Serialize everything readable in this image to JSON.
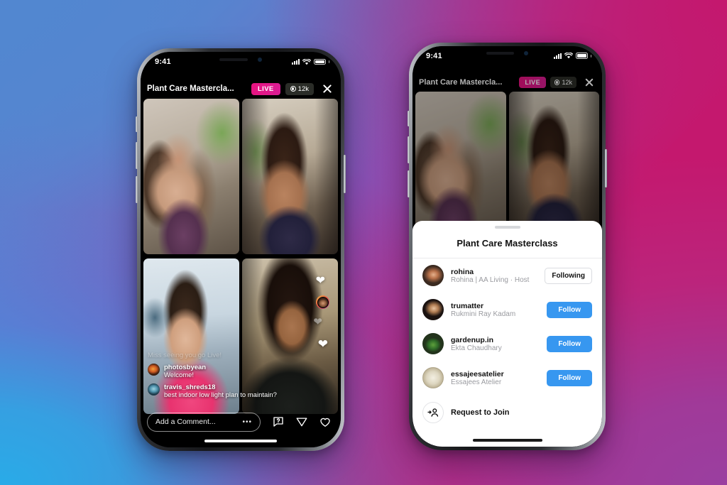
{
  "background": {
    "gradient_colors": [
      "#5287d0",
      "#29abe8",
      "#c4186e",
      "#9a3fa0"
    ]
  },
  "accents": {
    "live_pink": "#e8137f",
    "follow_blue": "#3797f0",
    "sheet_white": "#ffffff"
  },
  "phone_left": {
    "status_bar": {
      "time": "9:41",
      "signal_icon": "cellular-signal-icon",
      "wifi_icon": "wifi-icon",
      "battery_icon": "battery-icon"
    },
    "live_header": {
      "title": "Plant Care Mastercla...",
      "live_label": "LIVE",
      "viewer_count": "12k",
      "viewer_icon": "eye-icon",
      "close_icon": "close-icon"
    },
    "video_tiles": [
      {
        "name": "tile-top-left"
      },
      {
        "name": "tile-top-right"
      },
      {
        "name": "tile-bottom-left"
      },
      {
        "name": "tile-bottom-right"
      }
    ],
    "comments": [
      {
        "user": "",
        "text": "Miss seeing you go Live!",
        "faded": true
      },
      {
        "user": "photosbyean",
        "text": "Welcome!",
        "faded": false
      },
      {
        "user": "travis_shreds18",
        "text": "best indoor low light plan to maintain?",
        "faded": false
      }
    ],
    "composer": {
      "placeholder": "Add a Comment...",
      "more_label": "•••",
      "question_icon": "question-bubble-icon",
      "share_icon": "share-paper-plane-icon",
      "like_icon": "heart-icon"
    }
  },
  "phone_right": {
    "status_bar": {
      "time": "9:41"
    },
    "live_header": {
      "title": "Plant Care Mastercla...",
      "live_label": "LIVE",
      "viewer_count": "12k"
    },
    "sheet": {
      "title": "Plant Care Masterclass",
      "rows": [
        {
          "user": "rohina",
          "sub": "Rohina | AA Living · Host",
          "action": "Following",
          "action_style": "following",
          "avatar": "av-rohina"
        },
        {
          "user": "trumatter",
          "sub": "Rukmini Ray Kadam",
          "action": "Follow",
          "action_style": "follow",
          "avatar": "av-trumatter"
        },
        {
          "user": "gardenup.in",
          "sub": "Ekta Chaudhary",
          "action": "Follow",
          "action_style": "follow",
          "avatar": "av-gardenup"
        },
        {
          "user": "essajeesatelier",
          "sub": "Essajees Atelier",
          "action": "Follow",
          "action_style": "follow",
          "avatar": "av-essajees"
        }
      ],
      "request_to_join": {
        "label": "Request to Join",
        "icon": "add-person-icon"
      }
    }
  }
}
